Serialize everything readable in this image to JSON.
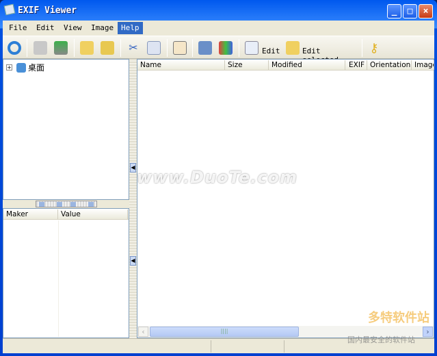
{
  "window": {
    "title": "EXIF Viewer"
  },
  "menu": {
    "items": [
      "File",
      "Edit",
      "View",
      "Image",
      "Help"
    ],
    "active": "Help"
  },
  "toolbar": {
    "edit_label": "Edit",
    "edit_selected_label": "Edit selected",
    "icons": [
      "refresh-icon",
      "print-icon",
      "save-icon",
      "new-folder-icon",
      "open-folder-icon",
      "cut-icon",
      "copy-icon",
      "select-columns-icon",
      "user-icon",
      "monitor-icon",
      "edit-icon",
      "edit-selected-icon",
      "key-icon"
    ]
  },
  "tree": {
    "items": [
      {
        "label": "桌面",
        "expand": "+"
      }
    ]
  },
  "properties": {
    "columns": [
      "Maker",
      "Value"
    ]
  },
  "files": {
    "columns": [
      "Name",
      "Size",
      "Modified",
      "EXIF",
      "Orientation",
      "Image"
    ]
  },
  "watermark": {
    "text": "www.DuoTe.com",
    "brand": "多特软件站",
    "slogan": "国内最安全的软件站"
  },
  "colors": {
    "titlebar": "#0050e0",
    "selection": "#316ac5",
    "face": "#ece9d8"
  }
}
